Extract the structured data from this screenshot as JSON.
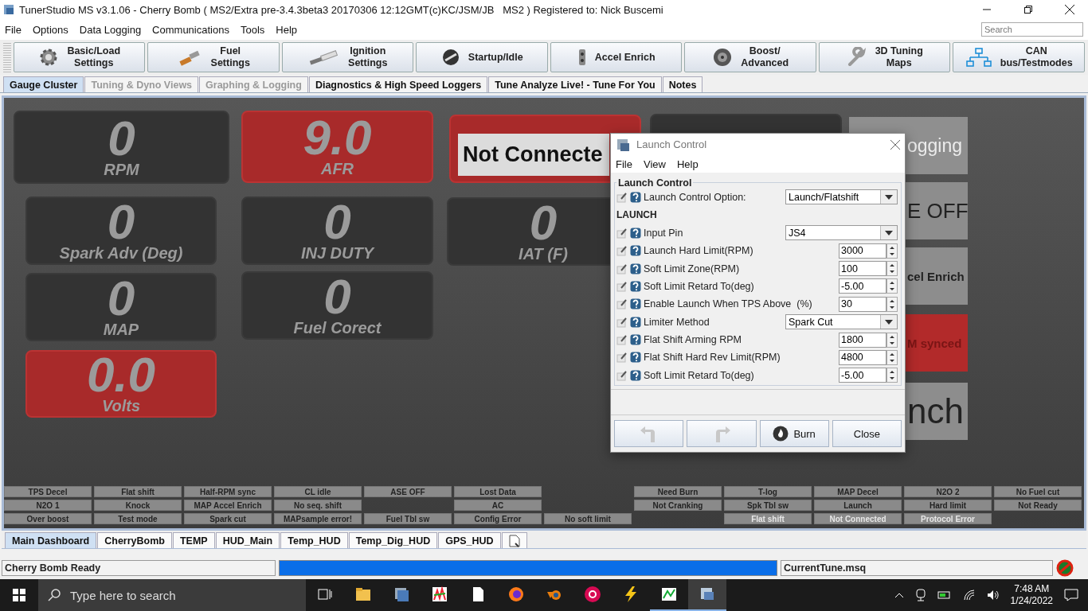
{
  "window": {
    "title": "TunerStudio MS v3.1.06 - Cherry Bomb ( MS2/Extra pre-3.4.3beta3 20170306 12:12GMT(c)KC/JSM/JB   MS2 ) Registered to: Nick Buscemi"
  },
  "menu": [
    "File",
    "Options",
    "Data Logging",
    "Communications",
    "Tools",
    "Help"
  ],
  "search": {
    "placeholder": "Search"
  },
  "toolbar": [
    {
      "lines": [
        "Basic/Load",
        "Settings"
      ]
    },
    {
      "lines": [
        "Fuel",
        "Settings"
      ]
    },
    {
      "lines": [
        "Ignition",
        "Settings"
      ]
    },
    {
      "lines": [
        "Startup/Idle"
      ]
    },
    {
      "lines": [
        "Accel Enrich"
      ]
    },
    {
      "lines": [
        "Boost/",
        "Advanced"
      ]
    },
    {
      "lines": [
        "3D Tuning",
        "Maps"
      ]
    },
    {
      "lines": [
        "CAN",
        "bus/Testmodes"
      ]
    }
  ],
  "tabs": [
    {
      "label": "Gauge Cluster",
      "selected": true,
      "disabled": false
    },
    {
      "label": "Tuning & Dyno Views",
      "selected": false,
      "disabled": true
    },
    {
      "label": "Graphing & Logging",
      "selected": false,
      "disabled": true
    },
    {
      "label": "Diagnostics & High Speed Loggers",
      "selected": false,
      "disabled": false
    },
    {
      "label": "Tune Analyze Live! - Tune For You",
      "selected": false,
      "disabled": false
    },
    {
      "label": "Notes",
      "selected": false,
      "disabled": false
    }
  ],
  "gauges": [
    {
      "value": "0",
      "label": "RPM",
      "alert": false
    },
    {
      "value": "9.0",
      "label": "AFR",
      "alert": true
    },
    {
      "alert": true
    },
    {
      "alert": false
    },
    {
      "value": "0",
      "label": "Spark Adv (Deg)",
      "alert": false
    },
    {
      "value": "0",
      "label": "INJ DUTY",
      "alert": false
    },
    {
      "value": "0",
      "label": "IAT (F)",
      "alert": false
    },
    {
      "value": "0",
      "label": "MAP",
      "alert": false
    },
    {
      "value": "0",
      "label": "Fuel Corect",
      "alert": false
    },
    {
      "value": "0.0",
      "label": "Volts",
      "alert": true
    }
  ],
  "not_connected_overlay": "Not Connecte",
  "side_indicators": [
    {
      "label": "ogging",
      "alert": false,
      "faded": true
    },
    {
      "label": "E OFF",
      "alert": false,
      "faded": false
    },
    {
      "label": "cel Enrich",
      "alert": false,
      "faded": false
    },
    {
      "label": "M synced",
      "alert": true,
      "faded": false
    },
    {
      "label": "nch",
      "alert": false,
      "faded": false
    }
  ],
  "indicators": [
    {
      "kind": "indicator",
      "label": "TPS Decel",
      "disabled": false
    },
    {
      "kind": "indicator",
      "label": "Flat shift",
      "disabled": false
    },
    {
      "kind": "indicator",
      "label": "Half-RPM sync",
      "disabled": false
    },
    {
      "kind": "indicator",
      "label": "CL idle",
      "disabled": false
    },
    {
      "kind": "indicator",
      "label": "ASE OFF",
      "disabled": false
    },
    {
      "kind": "indicator",
      "label": "Lost Data",
      "disabled": false
    },
    {
      "kind": "blank"
    },
    {
      "kind": "indicator",
      "label": "Need Burn",
      "disabled": false
    },
    {
      "kind": "indicator",
      "label": "T-log",
      "disabled": false
    },
    {
      "kind": "indicator",
      "label": "MAP Decel",
      "disabled": false
    },
    {
      "kind": "indicator",
      "label": "N2O 2",
      "disabled": false
    },
    {
      "kind": "indicator",
      "label": "No Fuel cut",
      "disabled": false
    },
    {
      "kind": "indicator",
      "label": "N2O 1",
      "disabled": false
    },
    {
      "kind": "indicator",
      "label": "Knock",
      "disabled": false
    },
    {
      "kind": "indicator",
      "label": "MAP Accel Enrich",
      "disabled": false
    },
    {
      "kind": "indicator",
      "label": "No seq. shift",
      "disabled": false
    },
    {
      "kind": "blank"
    },
    {
      "kind": "indicator",
      "label": "AC",
      "disabled": false
    },
    {
      "kind": "blank"
    },
    {
      "kind": "indicator",
      "label": "Not Cranking",
      "disabled": false
    },
    {
      "kind": "indicator",
      "label": "Spk Tbl sw",
      "disabled": false
    },
    {
      "kind": "indicator",
      "label": "Launch",
      "disabled": false
    },
    {
      "kind": "indicator",
      "label": "Hard limit",
      "disabled": false
    },
    {
      "kind": "indicator",
      "label": "Not Ready",
      "disabled": false
    },
    {
      "kind": "indicator",
      "label": "Over boost",
      "disabled": false
    },
    {
      "kind": "indicator",
      "label": "Test mode",
      "disabled": false
    },
    {
      "kind": "indicator",
      "label": "Spark cut",
      "disabled": false
    },
    {
      "kind": "indicator",
      "label": "MAPsample error!",
      "disabled": false
    },
    {
      "kind": "indicator",
      "label": "Fuel Tbl sw",
      "disabled": false
    },
    {
      "kind": "indicator",
      "label": "Config Error",
      "disabled": false
    },
    {
      "kind": "indicator",
      "label": "No soft limit",
      "disabled": false
    },
    {
      "kind": "blank"
    },
    {
      "kind": "indicator",
      "label": "Flat shift",
      "disabled": true
    },
    {
      "kind": "indicator",
      "label": "Not Connected",
      "disabled": true
    },
    {
      "kind": "indicator",
      "label": "Protocol Error",
      "disabled": true
    },
    {
      "kind": "blank"
    }
  ],
  "dashboard_tabs": [
    {
      "label": "Main Dashboard",
      "selected": true
    },
    {
      "label": "CherryBomb",
      "selected": false
    },
    {
      "label": "TEMP",
      "selected": false
    },
    {
      "label": "HUD_Main",
      "selected": false
    },
    {
      "label": "Temp_HUD",
      "selected": false
    },
    {
      "label": "Temp_Dig_HUD",
      "selected": false
    },
    {
      "label": "GPS_HUD",
      "selected": false
    }
  ],
  "status_bar": {
    "message": "Cherry Bomb Ready",
    "progress": {
      "level": 1.0
    },
    "file": "CurrentTune.msq"
  },
  "dialog": {
    "title": "Launch Control",
    "menu": [
      "File",
      "View",
      "Help"
    ],
    "group": "Launch Control",
    "rows": [
      {
        "kind": "select",
        "label": "Launch Control Option:",
        "value": "Launch/Flatshift"
      },
      {
        "kind": "heading",
        "label": "LAUNCH"
      },
      {
        "kind": "select",
        "label": "Input Pin",
        "value": "JS4"
      },
      {
        "kind": "spinner",
        "label": "Launch Hard Limit(RPM)",
        "value": "3000"
      },
      {
        "kind": "spinner",
        "label": "Soft Limit Zone(RPM)",
        "value": "100"
      },
      {
        "kind": "spinner",
        "label": "Soft Limit Retard To(deg)",
        "value": "-5.00"
      },
      {
        "kind": "spinner",
        "label": "Enable Launch When TPS Above",
        "unit": "(%)",
        "value": "30"
      },
      {
        "kind": "select",
        "label": "Limiter Method",
        "value": "Spark Cut"
      },
      {
        "kind": "spinner",
        "label": "Flat Shift Arming RPM",
        "value": "1800"
      },
      {
        "kind": "spinner",
        "label": "Flat Shift Hard Rev Limit(RPM)",
        "value": "4800"
      },
      {
        "kind": "spinner",
        "label": "Soft Limit Retard To(deg)",
        "value": "-5.00"
      }
    ],
    "buttons": [
      {
        "kind": "undo",
        "disabled": true
      },
      {
        "kind": "redo",
        "disabled": true
      },
      {
        "kind": "burn",
        "label": "Burn",
        "disabled": false
      },
      {
        "kind": "close",
        "label": "Close",
        "disabled": false
      }
    ]
  },
  "taskbar": {
    "search_placeholder": "Type here to search",
    "apps": [
      {
        "running": false,
        "selected": false
      },
      {
        "running": false,
        "selected": false
      },
      {
        "running": false,
        "selected": false
      },
      {
        "running": false,
        "selected": false
      },
      {
        "running": false,
        "selected": false
      },
      {
        "running": false,
        "selected": false
      },
      {
        "running": false,
        "selected": false
      },
      {
        "running": false,
        "selected": false
      },
      {
        "running": true,
        "selected": false
      },
      {
        "running": true,
        "selected": true
      }
    ],
    "time": "7:48 AM",
    "date": "1/24/2022"
  }
}
